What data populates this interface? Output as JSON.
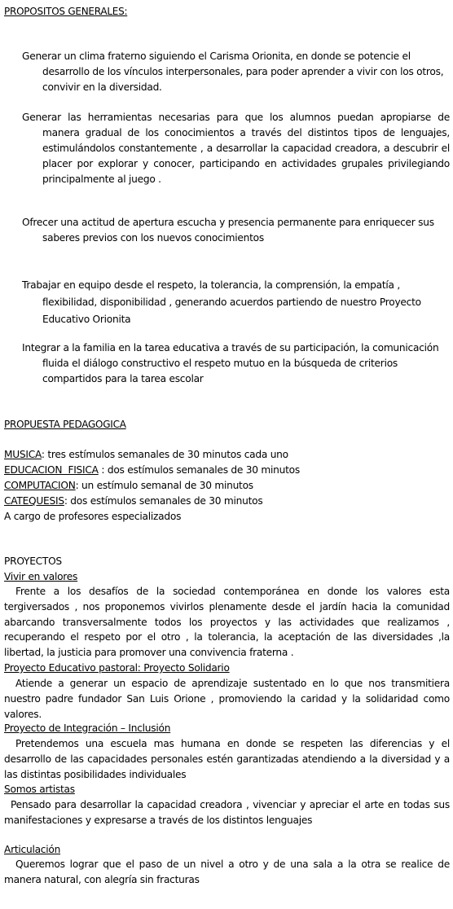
{
  "propositos": {
    "title": "PROPOSITOS GENERALES:",
    "items": [
      "Generar un clima  fraterno  siguiendo el Carisma Orionita, en donde se potencie el desarrollo de los vínculos interpersonales, para poder aprender a vivir con los otros,  convivir en la diversidad.",
      "Generar las herramientas necesarias para que los alumnos  puedan apropiarse de manera gradual de los conocimientos a través del distintos tipos de lenguajes, estimulándolos constantemente , a desarrollar la capacidad creadora, a descubrir el placer por explorar y conocer, participando en actividades grupales privilegiando  principalmente al juego .",
      "Ofrecer una actitud de apertura escucha y presencia permanente para  enriquecer sus saberes previos con los nuevos conocimientos",
      "Trabajar en equipo desde el respeto, la tolerancia, la comprensión, la empatía , flexibilidad, disponibilidad , generando acuerdos partiendo de nuestro Proyecto Educativo Orionita",
      "Integrar a la familia en la tarea educativa a través de su participación, la comunicación fluida el diálogo constructivo el respeto mutuo  en la búsqueda de criterios compartidos  para la tarea escolar"
    ]
  },
  "propuesta": {
    "title": "PROPUESTA PEDAGOGICA",
    "items": [
      {
        "subject": "MUSICA",
        "text": ": tres estímulos semanales de 30 minutos cada uno"
      },
      {
        "subject": "EDUCACION  FISICA",
        "text": " : dos estímulos semanales de 30 minutos"
      },
      {
        "subject": "COMPUTACION",
        "text": ": un estímulo semanal de 30 minutos"
      },
      {
        "subject": "CATEQUESIS",
        "text": ": dos estímulos semanales de 30 minutos"
      }
    ],
    "note": "A cargo de profesores especializados"
  },
  "proyectos": {
    "title": "PROYECTOS",
    "items": [
      {
        "title": "Vivir en valores",
        "text": "Frente a los desafíos de la sociedad contemporánea en donde los valores esta tergiversados , nos proponemos vivirlos plenamente desde el jardín hacia la comunidad abarcando  transversalmente todos los proyectos y  las actividades que realizamos , recuperando el respeto por el otro , la tolerancia, la aceptación de las diversidades ,la libertad, la justicia para promover una convivencia fraterna ."
      },
      {
        "title": "Proyecto Educativo pastoral: Proyecto Solidario",
        "text": "Atiende a generar un espacio de aprendizaje sustentado en lo que nos transmitiera nuestro padre fundador San Luis Orione , promoviendo la caridad y la solidaridad como valores."
      },
      {
        "title": "Proyecto de Integración – Inclusión",
        "text": "Pretendemos una escuela mas humana en donde se respeten las diferencias y el desarrollo de las capacidades personales estén garantizadas atendiendo a la diversidad y a las distintas posibilidades individuales"
      },
      {
        "title": "Somos artistas",
        "text": "Pensado para desarrollar la capacidad creadora , vivenciar  y apreciar el arte en todas sus manifestaciones  y expresarse a través de los distintos lenguajes"
      },
      {
        "title": "Articulación",
        "text": "Queremos lograr que el paso de un nivel a otro y de una sala a la otra se realice de manera natural, con alegría sin fracturas"
      }
    ]
  }
}
